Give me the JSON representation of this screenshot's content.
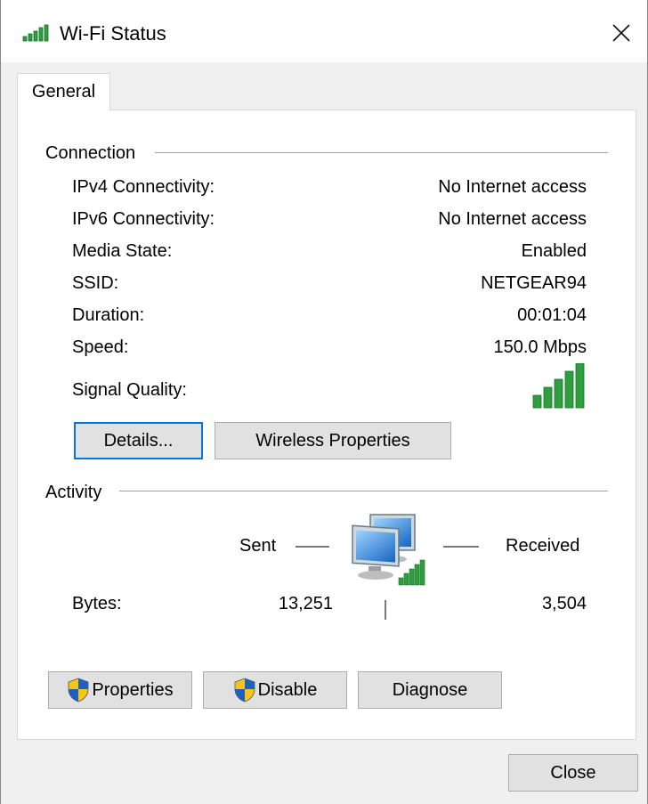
{
  "window": {
    "title": "Wi-Fi Status",
    "icon": "wifi-signal-icon",
    "close_icon": "close-icon",
    "close_button": "Close"
  },
  "tabs": [
    {
      "label": "General",
      "selected": true
    }
  ],
  "connection": {
    "heading": "Connection",
    "rows": [
      {
        "label": "IPv4 Connectivity:",
        "value": "No Internet access"
      },
      {
        "label": "IPv6 Connectivity:",
        "value": "No Internet access"
      },
      {
        "label": "Media State:",
        "value": "Enabled"
      },
      {
        "label": "SSID:",
        "value": "NETGEAR94"
      },
      {
        "label": "Duration:",
        "value": "00:01:04"
      },
      {
        "label": "Speed:",
        "value": "150.0 Mbps"
      }
    ],
    "signal_label": "Signal Quality:",
    "signal_bars": 5,
    "signal_max": 5,
    "details_button": "Details...",
    "wireless_properties_button": "Wireless Properties"
  },
  "activity": {
    "heading": "Activity",
    "sent_label": "Sent",
    "received_label": "Received",
    "bytes_label": "Bytes:",
    "bytes_sent": "13,251",
    "bytes_received": "3,504",
    "icon": "network-computers-icon"
  },
  "buttons": {
    "properties": "Properties",
    "disable": "Disable",
    "diagnose": "Diagnose"
  },
  "colors": {
    "signal_green": "#2e9e3e",
    "accent": "#0078d7",
    "button_face": "#e1e1e1",
    "shield_blue": "#1f5fbf",
    "shield_yellow": "#f5c518"
  }
}
